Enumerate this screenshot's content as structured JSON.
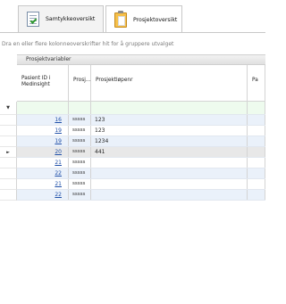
{
  "tabs": [
    {
      "label": "Samtykkeoversikt",
      "icon": "consent-sheet-icon",
      "active": false
    },
    {
      "label": "Prosjektoversikt",
      "icon": "clipboard-icon",
      "active": true
    }
  ],
  "group_hint": "Dra en eller flere kolonneoverskrifter hit for å gruppere utvalget",
  "band_title": "Prosjektvariabler",
  "columns": [
    {
      "label": "Pasient ID i Medinsight"
    },
    {
      "label": "Prosj..."
    },
    {
      "label": "Prosjektløpenr"
    },
    {
      "label": "Pa"
    }
  ],
  "indicators": {
    "new_row": "▼",
    "current_row": "►"
  },
  "rows": [
    {
      "id": "16",
      "prosj": "sssss",
      "lopenr": "123"
    },
    {
      "id": "19",
      "prosj": "sssss",
      "lopenr": "123"
    },
    {
      "id": "19",
      "prosj": "sssss",
      "lopenr": "1234"
    },
    {
      "id": "20",
      "prosj": "sssss",
      "lopenr": "441"
    },
    {
      "id": "21",
      "prosj": "sssss",
      "lopenr": ""
    },
    {
      "id": "22",
      "prosj": "sssss",
      "lopenr": ""
    },
    {
      "id": "21",
      "prosj": "sssss",
      "lopenr": ""
    },
    {
      "id": "22",
      "prosj": "sssss",
      "lopenr": ""
    }
  ],
  "colors": {
    "alt_row": "#eaf1fa",
    "selected_row": "#e8e8e8",
    "new_row": "#eefbee",
    "link": "#1f4fa8"
  }
}
